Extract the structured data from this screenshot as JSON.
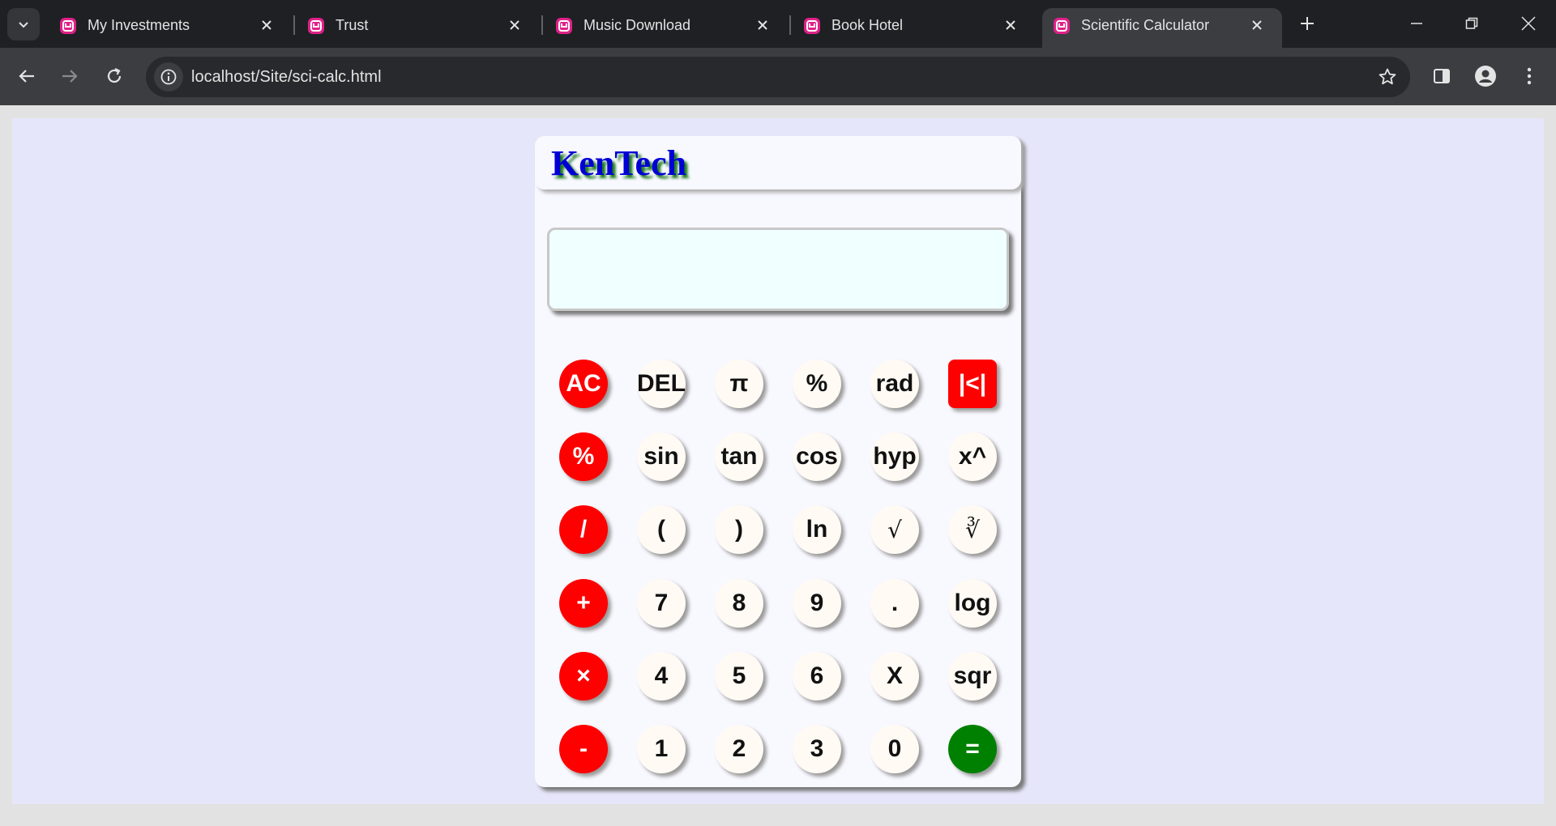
{
  "tabs": [
    {
      "title": "My Investments",
      "active": false
    },
    {
      "title": "Trust",
      "active": false
    },
    {
      "title": "Music Download",
      "active": false
    },
    {
      "title": "Book Hotel",
      "active": false
    },
    {
      "title": "Scientific Calculator",
      "active": true
    }
  ],
  "address_bar": {
    "url": "localhost/Site/sci-calc.html"
  },
  "calculator": {
    "brand": "KenTech",
    "display_value": "",
    "rows": [
      [
        {
          "label": "AC",
          "name": "all-clear",
          "style": "red"
        },
        {
          "label": "DEL",
          "name": "delete",
          "style": "light"
        },
        {
          "label": "π",
          "name": "pi",
          "style": "light"
        },
        {
          "label": "%",
          "name": "percent",
          "style": "light"
        },
        {
          "label": "rad",
          "name": "rad",
          "style": "light"
        },
        {
          "label": "|<|",
          "name": "abs",
          "style": "red-square"
        }
      ],
      [
        {
          "label": "%",
          "name": "modulo",
          "style": "red"
        },
        {
          "label": "sin",
          "name": "sin",
          "style": "light"
        },
        {
          "label": "tan",
          "name": "tan",
          "style": "light"
        },
        {
          "label": "cos",
          "name": "cos",
          "style": "light"
        },
        {
          "label": "hyp",
          "name": "hyp",
          "style": "light"
        },
        {
          "label": "x^",
          "name": "power",
          "style": "light"
        }
      ],
      [
        {
          "label": "/",
          "name": "divide",
          "style": "red"
        },
        {
          "label": "(",
          "name": "open-paren",
          "style": "light"
        },
        {
          "label": ")",
          "name": "close-paren",
          "style": "light"
        },
        {
          "label": "ln",
          "name": "ln",
          "style": "light"
        },
        {
          "label": "√",
          "name": "sqrt",
          "style": "light-serif"
        },
        {
          "label": "∛",
          "name": "cube-root",
          "style": "light-serif"
        }
      ],
      [
        {
          "label": "+",
          "name": "plus",
          "style": "red"
        },
        {
          "label": "7",
          "name": "seven",
          "style": "light"
        },
        {
          "label": "8",
          "name": "eight",
          "style": "light"
        },
        {
          "label": "9",
          "name": "nine",
          "style": "light"
        },
        {
          "label": ".",
          "name": "decimal",
          "style": "light"
        },
        {
          "label": "log",
          "name": "log",
          "style": "light"
        }
      ],
      [
        {
          "label": "×",
          "name": "multiply",
          "style": "red"
        },
        {
          "label": "4",
          "name": "four",
          "style": "light"
        },
        {
          "label": "5",
          "name": "five",
          "style": "light"
        },
        {
          "label": "6",
          "name": "six",
          "style": "light"
        },
        {
          "label": "X",
          "name": "x",
          "style": "light"
        },
        {
          "label": "sqr",
          "name": "square",
          "style": "light"
        }
      ],
      [
        {
          "label": "-",
          "name": "minus",
          "style": "red"
        },
        {
          "label": "1",
          "name": "one",
          "style": "light"
        },
        {
          "label": "2",
          "name": "two",
          "style": "light"
        },
        {
          "label": "3",
          "name": "three",
          "style": "light"
        },
        {
          "label": "0",
          "name": "zero",
          "style": "light"
        },
        {
          "label": "=",
          "name": "equals",
          "style": "green"
        }
      ]
    ]
  },
  "colors": {
    "red": "#ff0000",
    "green": "#008000",
    "page_bg": "#e6e6fa",
    "display_bg": "#f0ffff",
    "brand_text": "#0000d6"
  }
}
